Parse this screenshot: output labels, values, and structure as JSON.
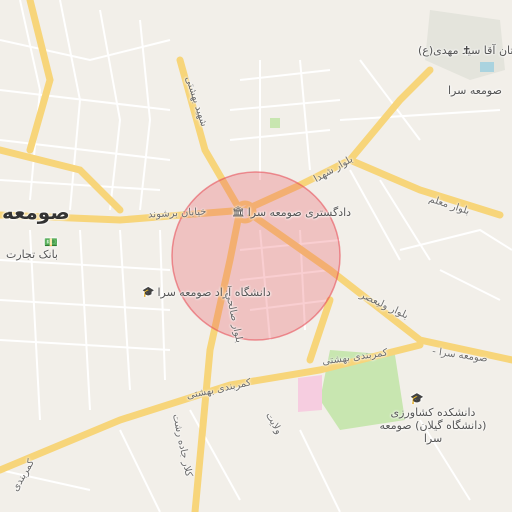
{
  "map": {
    "city_label": "صومعه",
    "labels": {
      "dadgostari": "دادگستری صومعه سرا",
      "azad_univ": "دانشگاه آزاد صومعه سرا",
      "agri_college": "دانشکده کشاورزی (دانشگاه گیلان) صومعه سرا",
      "bank": "بانک تجارت",
      "cemetery": "آرامستان آقا سید مهدی(ع)",
      "cemetery_sub": "صومعه سرا",
      "blvd_shohada": "بلوار شهدا",
      "blvd_moallem": "بلوار معلم",
      "blvd_valiasr": "بلوار ولیعصر",
      "blvd_salehi": "بلوار صالحی",
      "khiaban_bershavand": "خیابان برشوند",
      "kamarbandi_beheshti_1": "کمربندی بهشتی",
      "kamarbandi_beheshti_2": "کمربندی بهشتی",
      "somesara_road": "صومعه سرا -",
      "shahid_road": "شهید بهشتی",
      "kamarbandi_left": "کمربندی",
      "kalar_road": "کلار جاده رشت",
      "velayat": "ولایت"
    },
    "colors": {
      "background": "#f2efe9",
      "major_road": "#f7d57a",
      "minor_road": "#ffffff",
      "circle_fill": "#e8505a",
      "park": "#c8e6b0",
      "pink_area": "#f6cde0"
    },
    "search_radius_circle": "shown"
  }
}
